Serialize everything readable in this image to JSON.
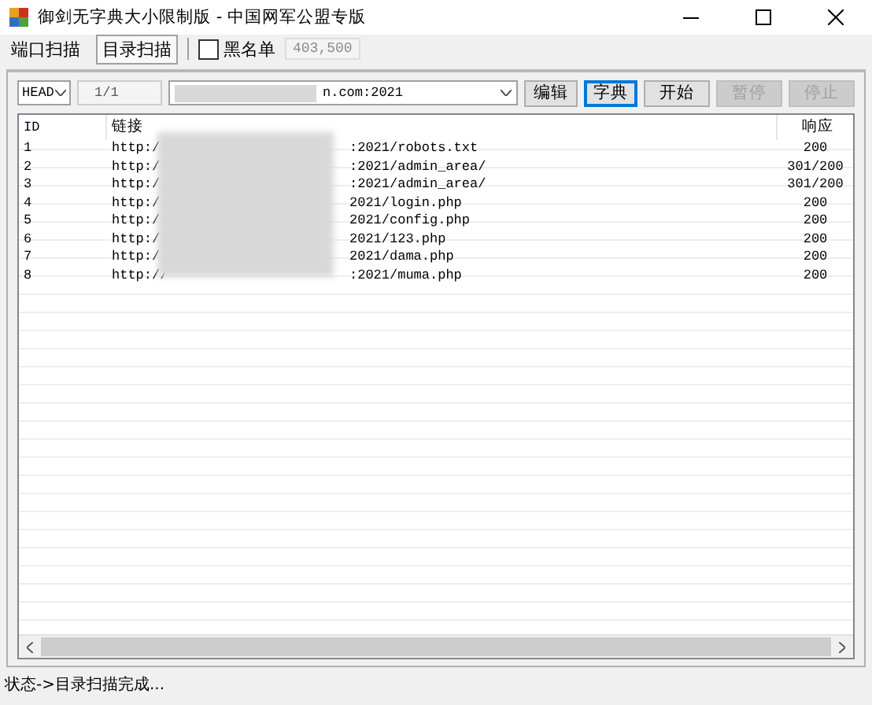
{
  "window": {
    "title": "御剑无字典大小限制版 - 中国网军公盟专版"
  },
  "tabs": [
    {
      "label": "端口扫描",
      "selected": false
    },
    {
      "label": "目录扫描",
      "selected": true
    }
  ],
  "blacklist": {
    "label": "黑名单",
    "checked": false,
    "value": "403,500"
  },
  "toolbar": {
    "method": "HEAD",
    "counter": "1/1",
    "url_end": "n.com:2021",
    "buttons": [
      {
        "label": "编辑",
        "focused": false,
        "disabled": false
      },
      {
        "label": "字典",
        "focused": true,
        "disabled": false
      },
      {
        "label": "开始",
        "focused": false,
        "disabled": false
      },
      {
        "label": "暂停",
        "focused": false,
        "disabled": true
      },
      {
        "label": "停止",
        "focused": false,
        "disabled": true
      }
    ]
  },
  "table": {
    "columns": [
      "ID",
      "链接",
      "响应"
    ],
    "rows": [
      {
        "id": "1",
        "link_start": "http:/",
        "link_end": ":2021/robots.txt",
        "response": "200"
      },
      {
        "id": "2",
        "link_start": "http:/",
        "link_end": ":2021/admin_area/",
        "response": "301/200"
      },
      {
        "id": "3",
        "link_start": "http:/",
        "link_end": ":2021/admin_area/",
        "response": "301/200"
      },
      {
        "id": "4",
        "link_start": "http:/",
        "link_end": "2021/login.php",
        "response": "200"
      },
      {
        "id": "5",
        "link_start": "http:/",
        "link_end": "2021/config.php",
        "response": "200"
      },
      {
        "id": "6",
        "link_start": "http:/",
        "link_end": "2021/123.php",
        "response": "200"
      },
      {
        "id": "7",
        "link_start": "http:/",
        "link_end": "2021/dama.php",
        "response": "200"
      },
      {
        "id": "8",
        "link_start": "http://",
        "link_end": ":2021/muma.php",
        "response": "200"
      }
    ]
  },
  "status_bar": "状态->目录扫描完成..."
}
